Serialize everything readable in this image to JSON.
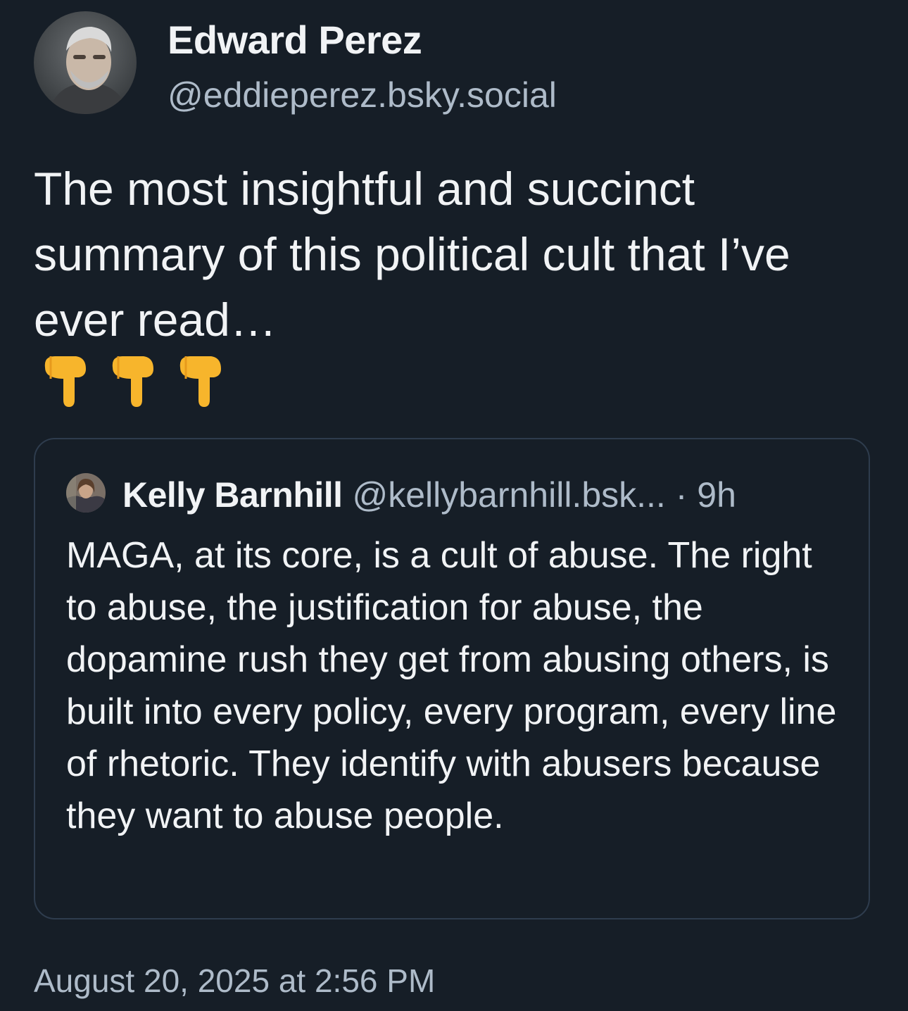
{
  "post": {
    "author_name": "Edward Perez",
    "author_handle": "@eddieperez.bsky.social",
    "text": "The most insightful and succinct summary of this political cult that I’ve ever read…",
    "emoji_icon": "backhand-index-pointing-down",
    "emoji_count": 3,
    "timestamp": "August 20, 2025 at 2:56 PM"
  },
  "quote": {
    "author_name": "Kelly Barnhill",
    "author_handle": "@kellybarnhill.bsk...",
    "separator": "·",
    "time_ago": "9h",
    "text": "MAGA, at its core, is a cult of abuse. The right to abuse, the justification for abuse, the dopamine rush they get from abusing others, is built into every policy, every program, every line of rhetoric. They identify with abusers because they want to abuse people."
  },
  "colors": {
    "background": "#161e27",
    "text_primary": "#f1f3f5",
    "text_secondary": "#aebbc9",
    "quote_border": "#2e3c4d",
    "emoji_yellow": "#f7b52c"
  }
}
